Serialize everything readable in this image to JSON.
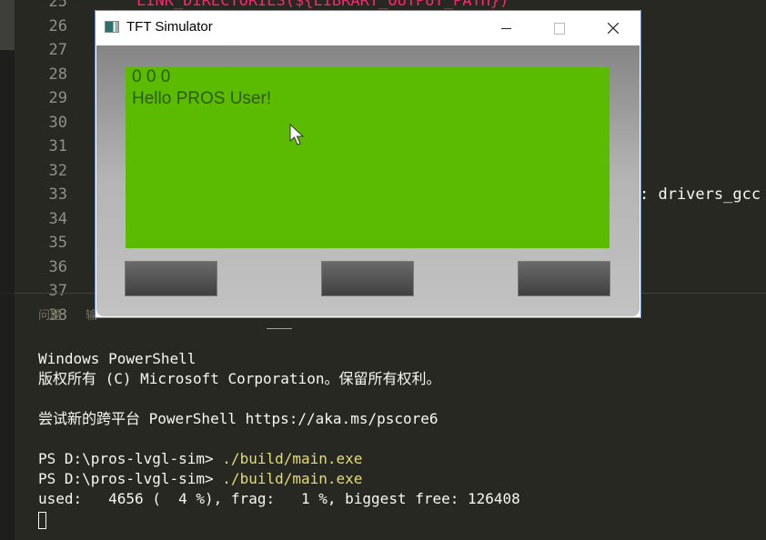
{
  "editor": {
    "line_numbers": [
      "25",
      "26",
      "27",
      "28",
      "29",
      "30",
      "31",
      "32",
      "33",
      "34",
      "35",
      "36",
      "37",
      "38"
    ],
    "line_25": "LINK_DIRECTORIES(${LIBRARY_OUTPUT_PATH})",
    "line_34": ": drivers_gcc"
  },
  "panel": {
    "tabs": [
      {
        "label": "问题"
      },
      {
        "label": "输"
      }
    ]
  },
  "terminal": {
    "lines": [
      {
        "text": "Windows PowerShell"
      },
      {
        "text": "版权所有 (C) Microsoft Corporation。保留所有权利。"
      },
      {
        "text": "尝试新的跨平台 PowerShell https://aka.ms/pscore6"
      },
      {
        "prompt": "PS D:\\pros-lvgl-sim> ",
        "cmd": "./build/main.exe"
      },
      {
        "prompt": "PS D:\\pros-lvgl-sim> ",
        "cmd": "./build/main.exe"
      },
      {
        "text": "used:   4656 (  4 %), frag:   1 %, biggest free: 126408"
      }
    ]
  },
  "window": {
    "title": "TFT Simulator",
    "minimize_icon": "minimize-icon",
    "maximize_icon": "maximize-icon",
    "close_icon": "close-icon",
    "screen": {
      "line1": "0 0 0",
      "line2": "Hello PROS User!",
      "color": "#5abb00"
    },
    "buttons": [
      "left",
      "center",
      "right"
    ]
  },
  "colors": {
    "background": "#272822",
    "keyword": "#f92672",
    "command": "#e6db74"
  }
}
